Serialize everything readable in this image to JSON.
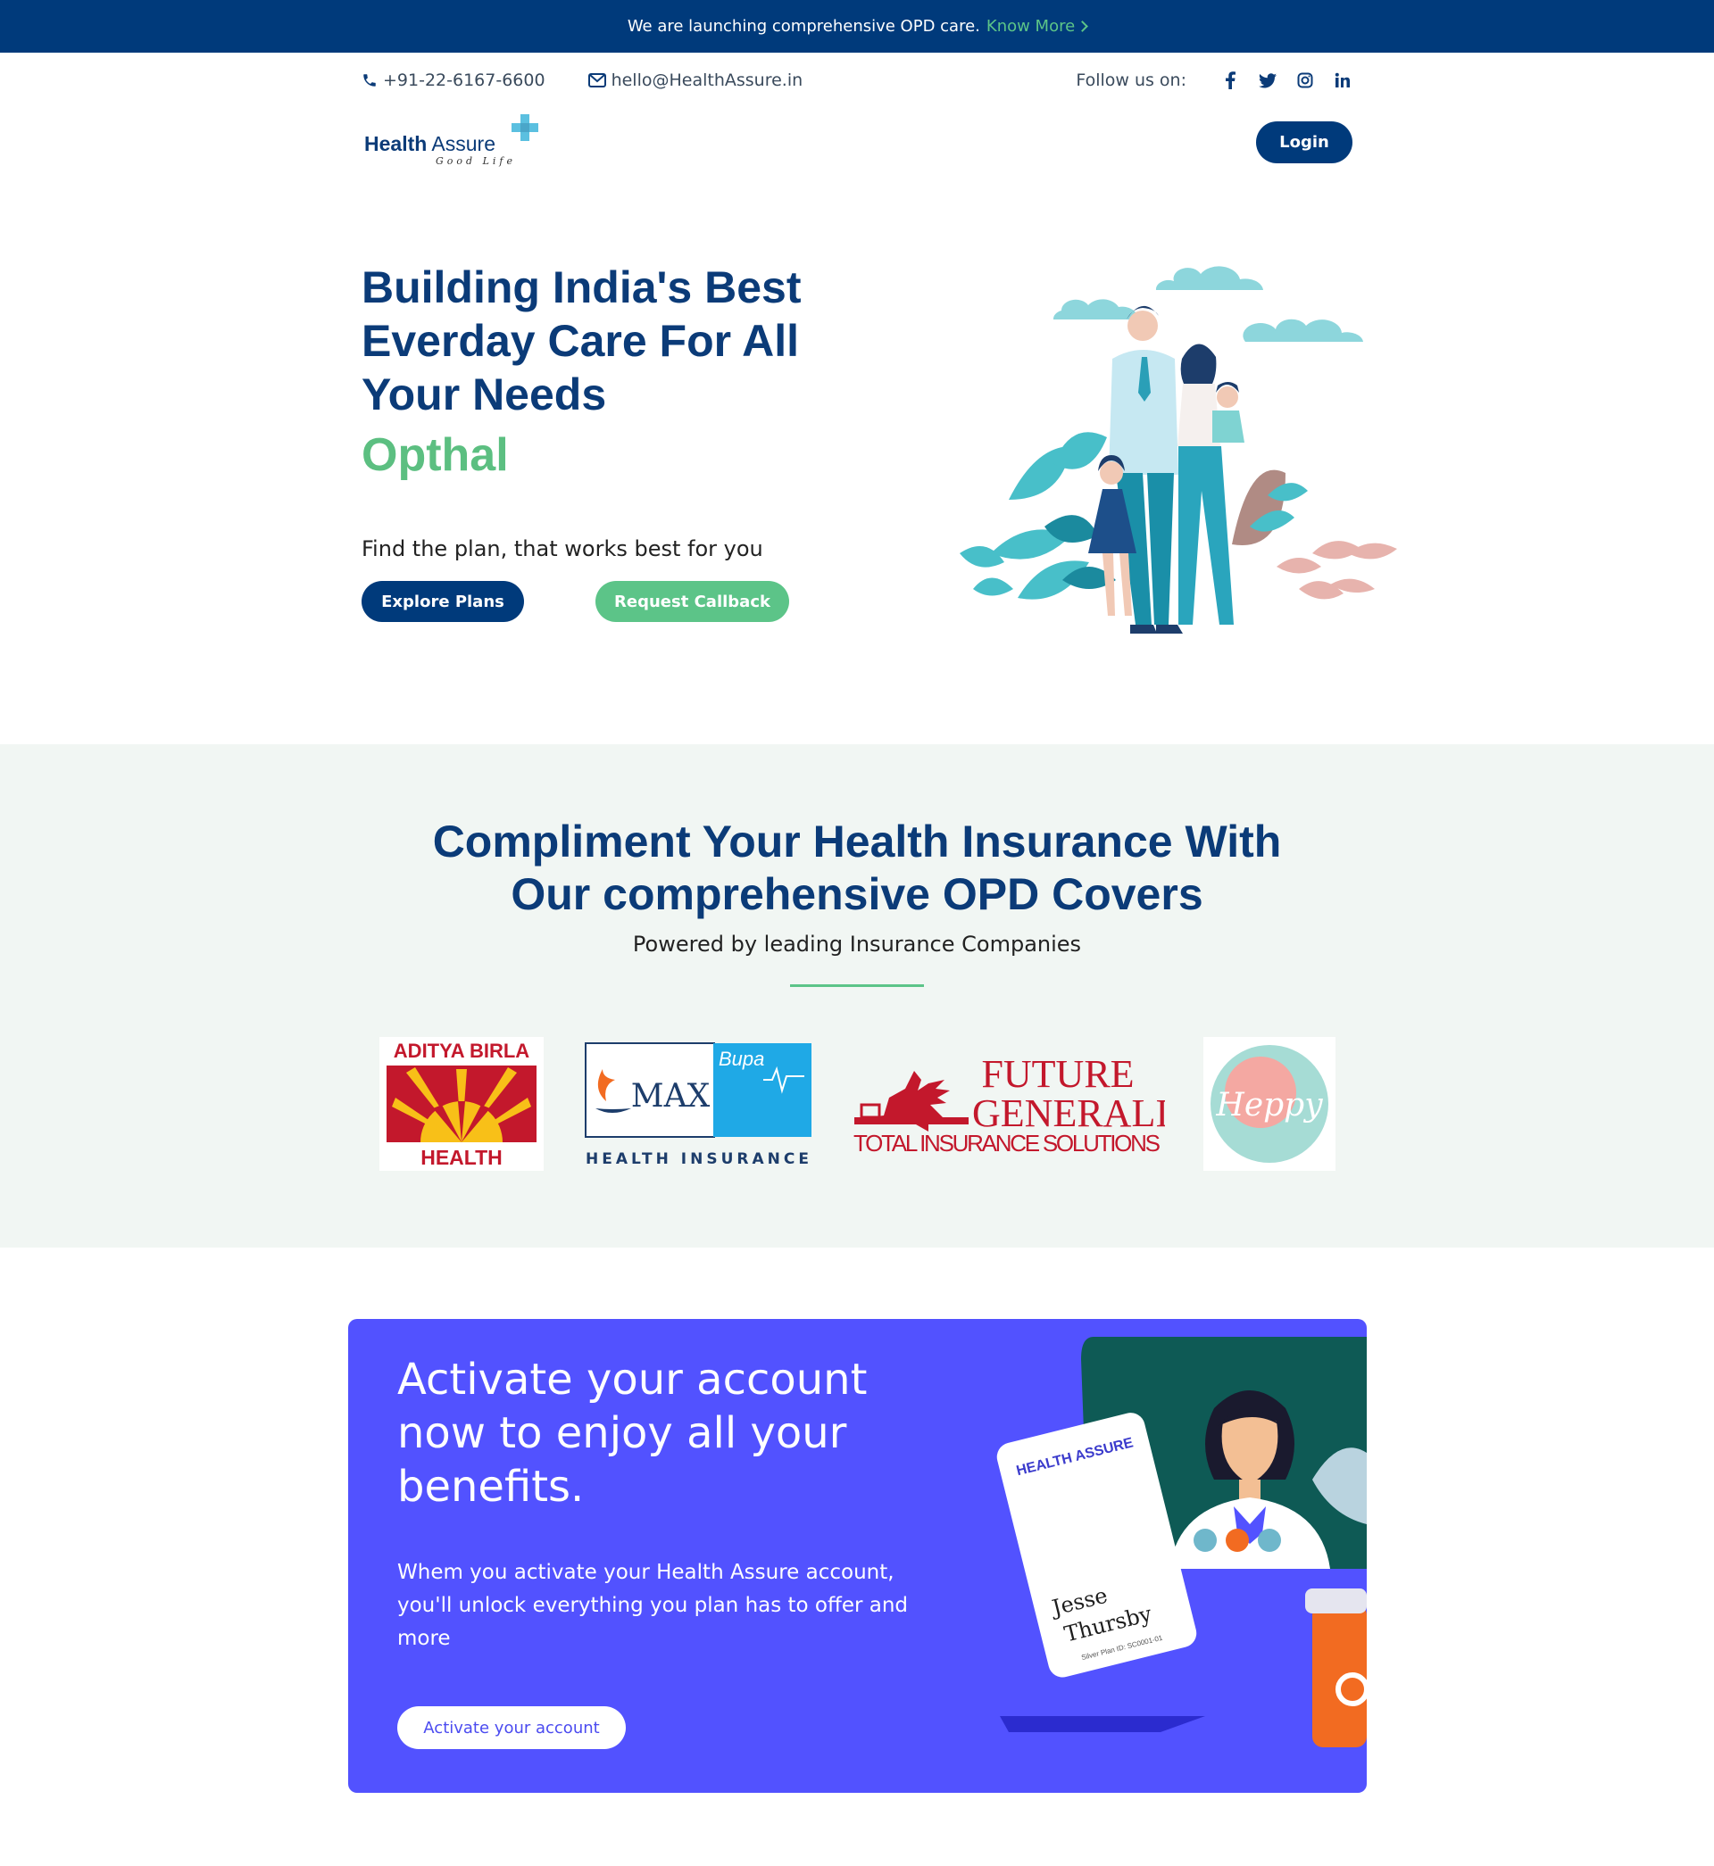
{
  "announcement": {
    "text": "We are launching comprehensive OPD care.",
    "link_label": "Know More"
  },
  "contact": {
    "phone": "+91-22-6167-6600",
    "email": "hello@HealthAssure.in",
    "follow_label": "Follow us on:"
  },
  "social": [
    {
      "icon": "facebook-icon",
      "glyph": "f"
    },
    {
      "icon": "twitter-icon",
      "glyph": "t"
    },
    {
      "icon": "instagram-icon",
      "glyph": "◎"
    },
    {
      "icon": "linkedin-icon",
      "glyph": "in"
    }
  ],
  "logo": {
    "word1": "Health",
    "word2": "Assure",
    "tagline": "Good Life"
  },
  "header": {
    "login_label": "Login"
  },
  "hero": {
    "title": "Building India's Best Everday Care For All Your Needs",
    "rotating_word": "Opthal",
    "subtitle": "Find the plan, that works best for you",
    "explore_label": "Explore Plans",
    "callback_label": "Request Callback"
  },
  "partners": {
    "title_line1": "Compliment Your Health Insurance With",
    "title_line2": "Our comprehensive OPD Covers",
    "subtitle": "Powered by leading Insurance Companies",
    "logos": {
      "aditya_top": "ADITYA BIRLA",
      "aditya_bottom": "HEALTH",
      "max_word": "MAX",
      "bupa_word": "Bupa",
      "max_bottom": "HEALTH INSURANCE",
      "fg_line1": "FUTURE",
      "fg_line2": "GENERALI",
      "fg_line3": "TOTAL INSURANCE SOLUTIONS",
      "heppy": "Heppy"
    }
  },
  "activate": {
    "title": "Activate your account now to enjoy all your benefits.",
    "body": "Whem you activate your Health Assure account, you'll unlock everything you plan has to offer and more",
    "button_label": "Activate your account",
    "card_brand": "HEALTH ASSURE",
    "card_name_first": "Jesse",
    "card_name_last": "Thursby",
    "card_plan": "Silver Plan ID: SC0001-01"
  },
  "colors": {
    "navy": "#003a7b",
    "green": "#5cc488",
    "purple": "#5252ff",
    "section_bg": "#f1f6f3"
  }
}
